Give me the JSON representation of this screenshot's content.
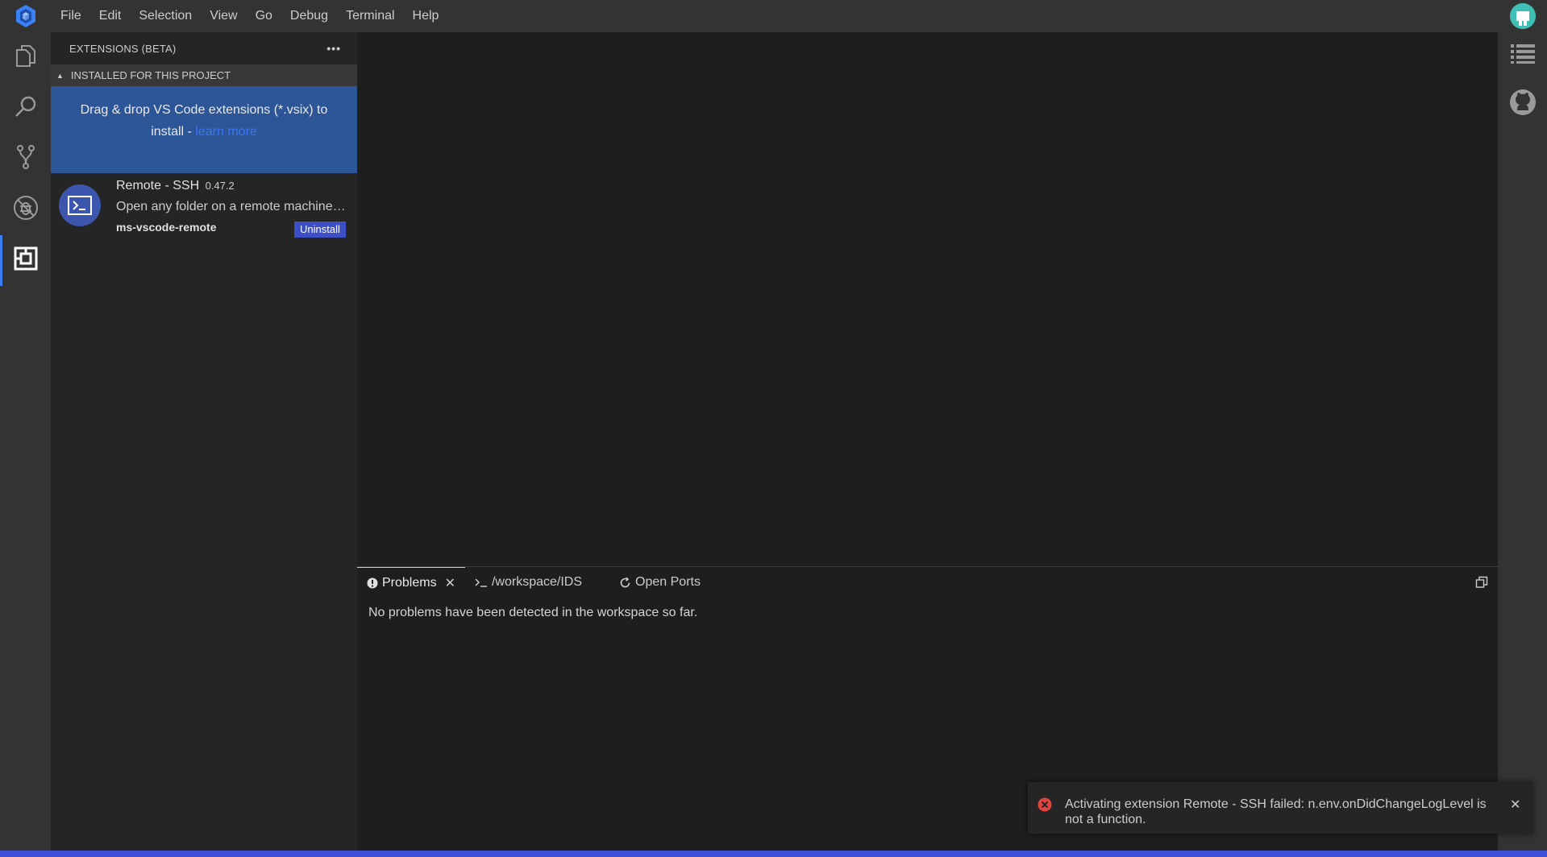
{
  "menu": {
    "items": [
      "File",
      "Edit",
      "Selection",
      "View",
      "Go",
      "Debug",
      "Terminal",
      "Help"
    ]
  },
  "activity_bar": {
    "icons": [
      "explorer-icon",
      "search-icon",
      "source-control-icon",
      "debug-icon",
      "extensions-icon"
    ],
    "active": "extensions-icon"
  },
  "right_bar": {
    "icons": [
      "outline-icon",
      "github-icon"
    ]
  },
  "sidebar": {
    "title": "EXTENSIONS (BETA)",
    "more_label": "•••",
    "section_title": "INSTALLED FOR THIS PROJECT",
    "drop_hint": {
      "text": "Drag & drop VS Code extensions (*.vsix) to install - ",
      "link": "learn more"
    },
    "extensions": [
      {
        "name": "Remote - SSH",
        "version": "0.47.2",
        "description": "Open any folder on a remote machine using SSH and take advantage of VS Code's full feature set.",
        "publisher": "ms-vscode-remote",
        "action": "Uninstall"
      }
    ]
  },
  "panel": {
    "tabs": [
      {
        "label": "Problems",
        "icon": "info-icon",
        "closable": true,
        "active": true
      },
      {
        "label": "/workspace/IDS",
        "icon": "terminal-icon",
        "closable": false,
        "active": false
      },
      {
        "label": "Open Ports",
        "icon": "refresh-icon",
        "closable": false,
        "active": false
      }
    ],
    "message": "No problems have been detected in the workspace so far."
  },
  "notification": {
    "type": "error",
    "message": "Activating extension Remote - SSH failed: n.env.onDidChangeLogLevel is not a function."
  },
  "colors": {
    "accent": "#3d7ef2",
    "statusbar": "#3d4ed8",
    "drop_hint_bg": "#2d5699",
    "button": "#3c4fc4",
    "error": "#e0443e"
  }
}
